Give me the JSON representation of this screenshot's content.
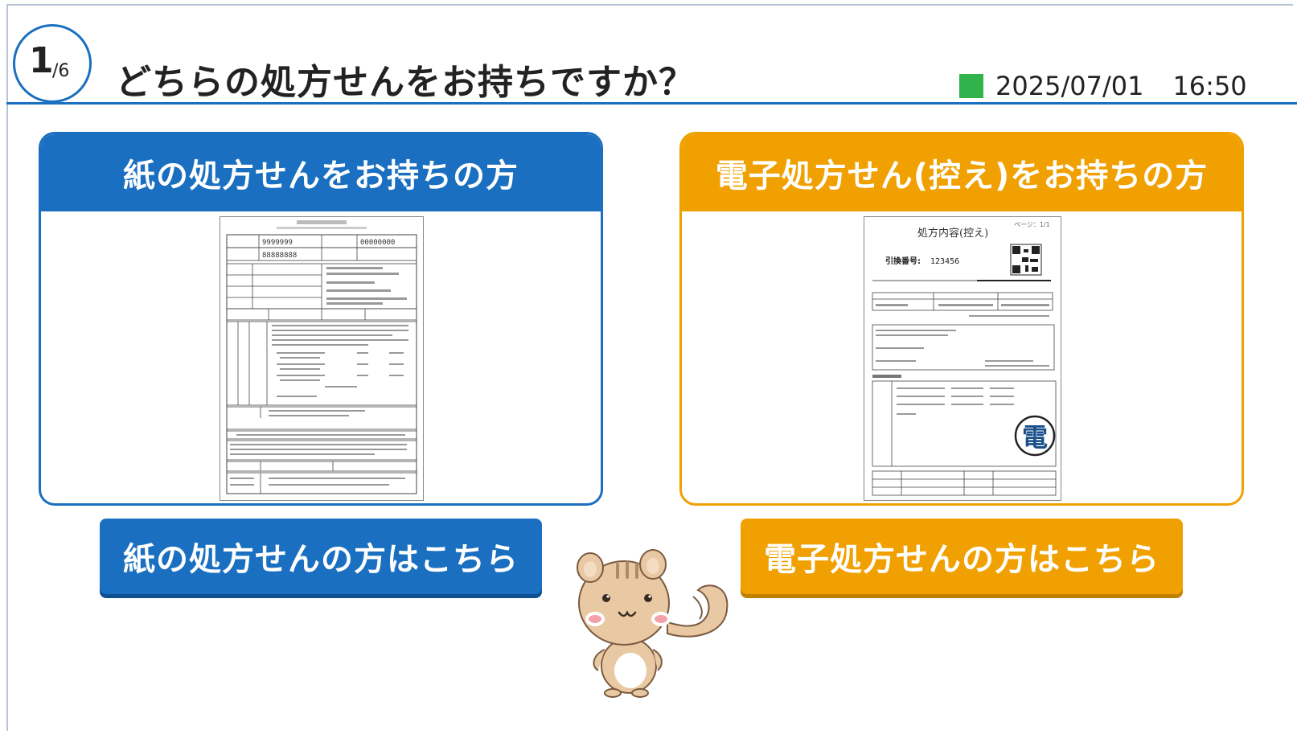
{
  "header": {
    "step": {
      "current": "1",
      "sep_total": "/6"
    },
    "title": "どちらの処方せんをお持ちですか？",
    "date": "2025/07/01",
    "time": "16:50",
    "status_color": "#2fb34a"
  },
  "options": {
    "paper": {
      "card_title": "紙の処方せんをお持ちの方",
      "button_label": "紙の処方せんの方はこちら",
      "color": "#1a6fc0"
    },
    "electronic": {
      "card_title": "電子処方せん(控え)をお持ちの方",
      "button_label": "電子処方せんの方はこちら",
      "color": "#f0a000"
    }
  },
  "sample_docs": {
    "paper": {
      "digits_a": "9999999",
      "digits_b": "88888888",
      "digits_c": "00000000"
    },
    "electronic": {
      "title": "処方内容(控え)",
      "page": "ページ：1/1",
      "ref_label": "引換番号:",
      "ref_number": "123456",
      "badge": "電"
    }
  },
  "mascot": {
    "icon": "squirrel-mascot"
  }
}
